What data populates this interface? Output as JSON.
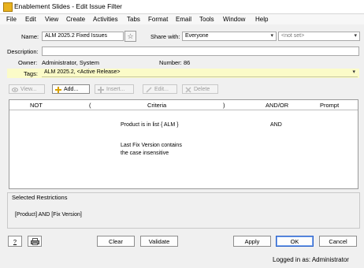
{
  "window": {
    "title": "Enablement Slides - Edit Issue Filter"
  },
  "menu": [
    {
      "label": "File"
    },
    {
      "label": "Edit"
    },
    {
      "label": "View"
    },
    {
      "label": "Create"
    },
    {
      "label": "Activities"
    },
    {
      "label": "Tabs"
    },
    {
      "label": "Format"
    },
    {
      "label": "Email"
    },
    {
      "label": "Tools"
    },
    {
      "label": "Window"
    },
    {
      "label": "Help"
    }
  ],
  "form": {
    "name_label": "Name:",
    "name_value": "ALM 2025.2 Fixed Issues",
    "share_label": "Share with:",
    "share_value": "Everyone",
    "notset_value": "<not set>",
    "description_label": "Description:",
    "description_value": "",
    "owner_label": "Owner:",
    "owner_value": "Administrator, System",
    "number_label": "Number:",
    "number_value": "86",
    "tags_label": "Tags:",
    "tags_value": "ALM 2025.2, <Active Release>"
  },
  "toolbar": {
    "view": "View...",
    "add": "Add...",
    "insert": "Insert...",
    "edit": "Edit...",
    "delete": "Delete"
  },
  "criteria": {
    "headers": [
      "NOT",
      "(",
      "Criteria",
      ")",
      "AND/OR",
      "Prompt"
    ],
    "rows": [
      {
        "criteria": "Product is in list { ALM }",
        "andor": "AND"
      },
      {
        "criteria": "Last Fix Version contains",
        "andor": ""
      },
      {
        "criteria": "the case insensitive",
        "andor": ""
      }
    ]
  },
  "restrictions": {
    "title": "Selected Restrictions",
    "text": "[Product]  AND  [Fix Version]"
  },
  "buttons": {
    "help": "?",
    "clear": "Clear",
    "validate": "Validate",
    "apply": "Apply",
    "ok": "OK",
    "cancel": "Cancel"
  },
  "status": {
    "text": "Logged in as: Administrator"
  },
  "colors": {
    "tags_highlight": "#fbfbc8",
    "ok_border": "#2d62c8",
    "app_icon": "#e8b21e"
  }
}
